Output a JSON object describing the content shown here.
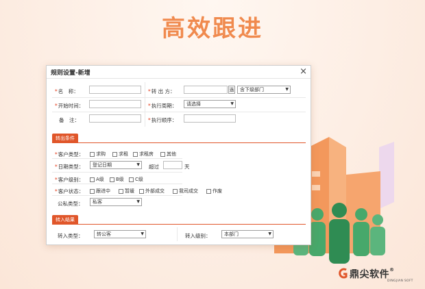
{
  "hero": {
    "title": "高效跟进"
  },
  "dialog": {
    "title": "规则设置-新增",
    "close": "×"
  },
  "form": {
    "name_label": "名　称：",
    "transfer_label": "转 出 方：",
    "transfer_pick": "选",
    "transfer_dept": "含下级部门",
    "start_time_label": "开始时间：",
    "exec_period_label": "执行周期：",
    "exec_period_value": "请选择",
    "remark_label": "备　注：",
    "exec_order_label": "执行顺序："
  },
  "transfer_conditions": {
    "section_title": "转出条件",
    "customer_type_label": "客户类型：",
    "customer_type_options": [
      "求购",
      "求租",
      "求租房",
      "其他"
    ],
    "date_type_label": "日期类型：",
    "date_type_value": "登记日期",
    "exceed_label": "超过",
    "days_unit": "天",
    "customer_level_label": "客户级别：",
    "customer_level_options": [
      "A级",
      "B级",
      "C级"
    ],
    "customer_status_label": "客户状态：",
    "customer_status_options": [
      "跟进中",
      "暂缓",
      "外部成交",
      "我司成交",
      "作废"
    ],
    "pubpriv_label": "公私类型：",
    "pubpriv_value": "私客"
  },
  "transfer_result": {
    "section_title": "转入结果",
    "in_type_label": "转入类型：",
    "in_type_value": "转公客",
    "in_level_label": "转入级别：",
    "in_level_value": "本部门"
  },
  "brand": {
    "name": "鼎尖软件",
    "reg": "®",
    "sub": "DINGJIAN SOFT"
  },
  "colors": {
    "accent": "#e0562a",
    "hero": "#f08a4e",
    "people": "#3c9a5f",
    "building": "#f3985c"
  }
}
